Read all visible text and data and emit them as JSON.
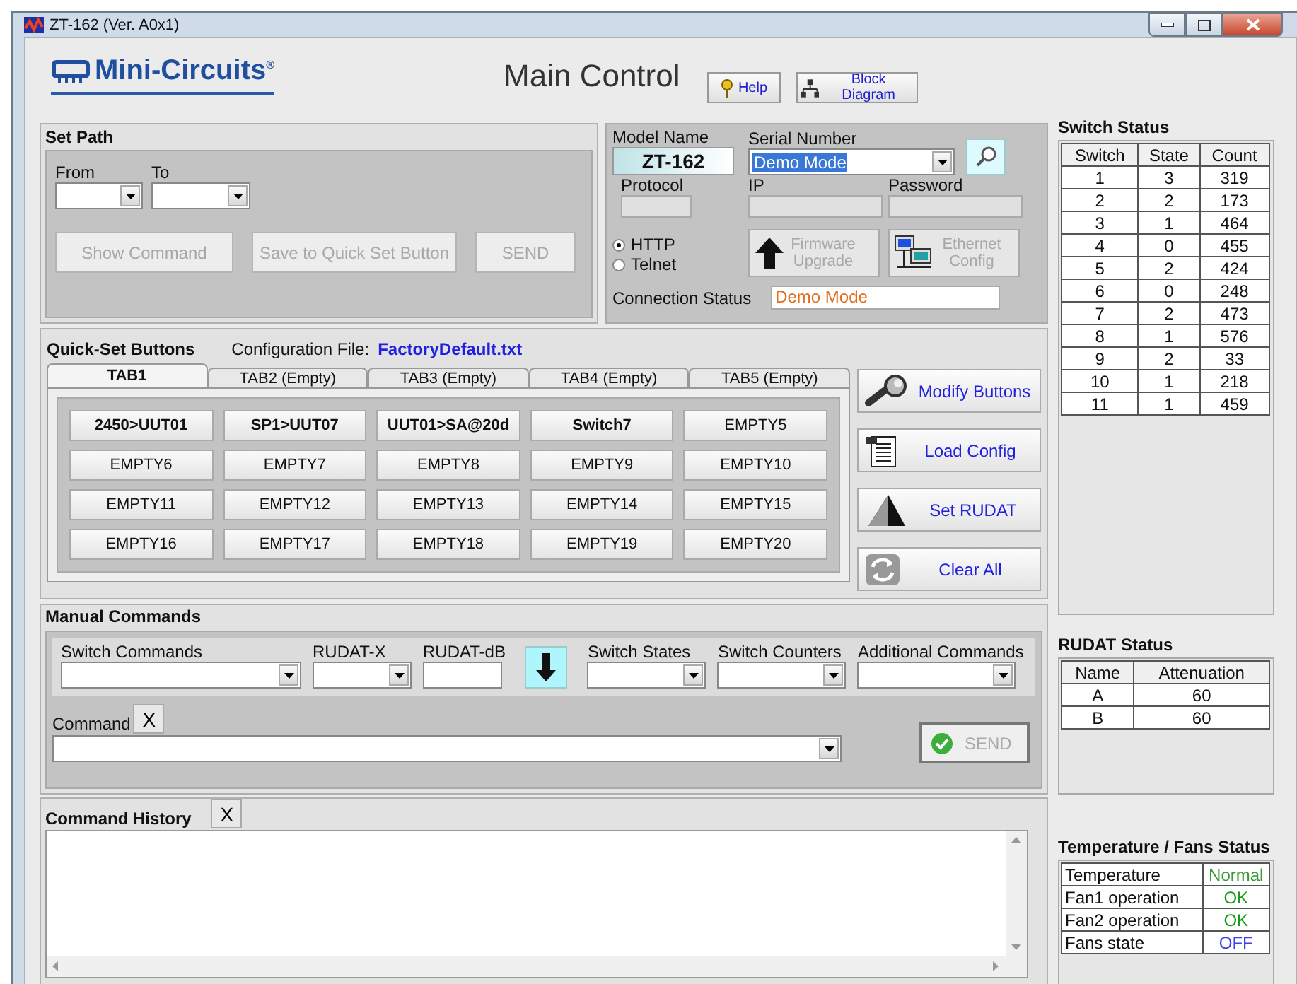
{
  "window": {
    "title": "ZT-162 (Ver. A0x1)"
  },
  "header": {
    "logo": "Mini-Circuits$^{®}$",
    "title": "Main Control",
    "buttons": [
      {
        "label": "Help",
        "kind": "help"
      },
      {
        "label": "Block Diagram",
        "kind": "diagram"
      }
    ]
  },
  "set_path": {
    "title": "Set Path",
    "fields": [
      {
        "label": "From"
      },
      {
        "label": "To"
      }
    ],
    "buttons": [
      {
        "label": "Show Command",
        "disabled": true
      },
      {
        "label": "Save to Quick Set Button",
        "disabled": true
      },
      {
        "label": "SEND",
        "disabled": true
      }
    ]
  },
  "connection": {
    "model_name": {
      "label": "Model Name",
      "value": "ZT-162"
    },
    "serial_number": {
      "label": "Serial Number",
      "value": "Demo Mode"
    },
    "fields": [
      {
        "label": "Protocol"
      },
      {
        "label": "IP"
      },
      {
        "label": "Password"
      }
    ],
    "protocols": [
      {
        "label": "HTTP",
        "selected": true
      },
      {
        "label": "Telnet",
        "selected": false
      }
    ],
    "buttons": [
      {
        "label": "Firmware Upgrade",
        "kind": "upload",
        "disabled": true
      },
      {
        "label": "Ethernet Config",
        "kind": "network",
        "disabled": true
      }
    ],
    "status": {
      "label": "Connection Status",
      "value": "Demo Mode"
    }
  },
  "quick_set": {
    "title": "Quick-Set Buttons",
    "config_label": "Configuration File:",
    "config_file": "FactoryDefault.txt",
    "tabs": [
      {
        "label": "TAB1",
        "selected": true
      },
      {
        "label": "TAB2 (Empty)",
        "selected": false
      },
      {
        "label": "TAB3 (Empty)",
        "selected": false
      },
      {
        "label": "TAB4 (Empty)",
        "selected": false
      },
      {
        "label": "TAB5 (Empty)",
        "selected": false
      }
    ],
    "buttons": [
      {
        "label": "2450>UUT01",
        "assigned": true
      },
      {
        "label": "SP1>UUT07",
        "assigned": true
      },
      {
        "label": "UUT01>SA@20d",
        "assigned": true
      },
      {
        "label": "Switch7",
        "assigned": true
      },
      {
        "label": "EMPTY5",
        "assigned": false
      },
      {
        "label": "EMPTY6",
        "assigned": false
      },
      {
        "label": "EMPTY7",
        "assigned": false
      },
      {
        "label": "EMPTY8",
        "assigned": false
      },
      {
        "label": "EMPTY9",
        "assigned": false
      },
      {
        "label": "EMPTY10",
        "assigned": false
      },
      {
        "label": "EMPTY11",
        "assigned": false
      },
      {
        "label": "EMPTY12",
        "assigned": false
      },
      {
        "label": "EMPTY13",
        "assigned": false
      },
      {
        "label": "EMPTY14",
        "assigned": false
      },
      {
        "label": "EMPTY15",
        "assigned": false
      },
      {
        "label": "EMPTY16",
        "assigned": false
      },
      {
        "label": "EMPTY17",
        "assigned": false
      },
      {
        "label": "EMPTY18",
        "assigned": false
      },
      {
        "label": "EMPTY19",
        "assigned": false
      },
      {
        "label": "EMPTY20",
        "assigned": false
      }
    ],
    "actions": [
      {
        "label": "Modify Buttons",
        "kind": "wrench"
      },
      {
        "label": "Load Config",
        "kind": "document"
      },
      {
        "label": "Set RUDAT",
        "kind": "triangle"
      },
      {
        "label": "Clear All",
        "kind": "refresh"
      }
    ]
  },
  "manual": {
    "title": "Manual Commands",
    "fields": [
      {
        "label": "Switch Commands",
        "kind": "dropdown"
      },
      {
        "label": "RUDAT-X",
        "kind": "dropdown"
      },
      {
        "label": "RUDAT-dB",
        "kind": "input"
      },
      {
        "kind": "arrow"
      },
      {
        "label": "Switch States",
        "kind": "dropdown"
      },
      {
        "label": "Switch Counters",
        "kind": "dropdown"
      },
      {
        "label": "Additional Commands",
        "kind": "dropdown"
      }
    ],
    "command_label": "Command",
    "command_clear": "X",
    "send": {
      "label": "SEND",
      "disabled": true
    }
  },
  "history": {
    "title": "Command History",
    "clear": "X"
  },
  "switch_status": {
    "title": "Switch Status",
    "columns": [
      "Switch",
      "State",
      "Count"
    ],
    "rows": [
      [
        "1",
        "3",
        "319"
      ],
      [
        "2",
        "2",
        "173"
      ],
      [
        "3",
        "1",
        "464"
      ],
      [
        "4",
        "0",
        "455"
      ],
      [
        "5",
        "2",
        "424"
      ],
      [
        "6",
        "0",
        "248"
      ],
      [
        "7",
        "2",
        "473"
      ],
      [
        "8",
        "1",
        "576"
      ],
      [
        "9",
        "2",
        "33"
      ],
      [
        "10",
        "1",
        "218"
      ],
      [
        "11",
        "1",
        "459"
      ]
    ]
  },
  "rudat_status": {
    "title": "RUDAT Status",
    "columns": [
      "Name",
      "Attenuation"
    ],
    "rows": [
      [
        "A",
        "60"
      ],
      [
        "B",
        "60"
      ]
    ]
  },
  "temp_status": {
    "title": "Temperature / Fans Status",
    "rows": [
      {
        "name": "Temperature",
        "value": "Normal",
        "color": "#3a9a3a"
      },
      {
        "name": "Fan1 operation",
        "value": "OK",
        "color": "#1a9a1a"
      },
      {
        "name": "Fan2 operation",
        "value": "OK",
        "color": "#1a9a1a"
      },
      {
        "name": "Fans state",
        "value": "OFF",
        "color": "#4040f0"
      }
    ]
  }
}
